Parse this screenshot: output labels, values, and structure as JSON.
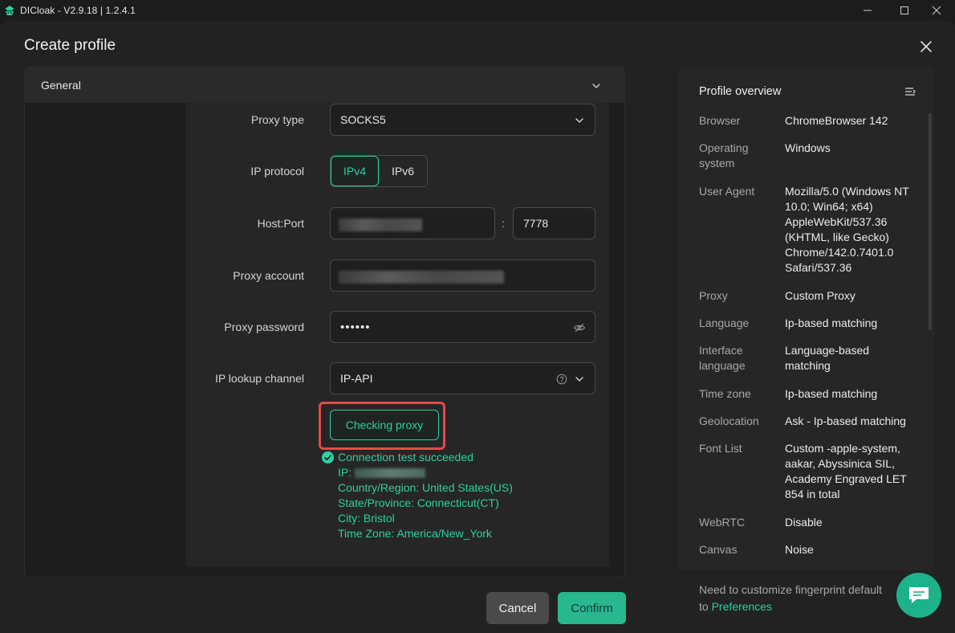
{
  "window": {
    "title": "DICloak - V2.9.18 | 1.2.4.1"
  },
  "dialog": {
    "title": "Create profile"
  },
  "section": {
    "title": "General"
  },
  "form": {
    "proxy_type_label": "Proxy type",
    "proxy_type_value": "SOCKS5",
    "ip_protocol_label": "IP protocol",
    "ip_protocol_options": [
      "IPv4",
      "IPv6"
    ],
    "ip_protocol_selected": "IPv4",
    "host_port_label": "Host:Port",
    "host_port_separator": ":",
    "port_value": "7778",
    "proxy_account_label": "Proxy account",
    "proxy_password_label": "Proxy password",
    "proxy_password_value": "••••••",
    "ip_lookup_label": "IP lookup channel",
    "ip_lookup_value": "IP-API",
    "check_button": "Checking proxy"
  },
  "result": {
    "status": "Connection test succeeded",
    "ip_label": "IP:",
    "country": "Country/Region: United States(US)",
    "state": "State/Province: Connecticut(CT)",
    "city": "City: Bristol",
    "timezone": "Time Zone: America/New_York"
  },
  "footer": {
    "cancel": "Cancel",
    "confirm": "Confirm"
  },
  "overview": {
    "title": "Profile overview",
    "rows": [
      {
        "label": "Browser",
        "value": "ChromeBrowser 142"
      },
      {
        "label": "Operating system",
        "value": "Windows"
      },
      {
        "label": "User Agent",
        "value": "Mozilla/5.0 (Windows NT 10.0; Win64; x64) AppleWebKit/537.36 (KHTML, like Gecko) Chrome/142.0.7401.0 Safari/537.36"
      },
      {
        "label": "Proxy",
        "value": "Custom Proxy"
      },
      {
        "label": "Language",
        "value": "Ip-based matching"
      },
      {
        "label": "Interface language",
        "value": "Language-based matching"
      },
      {
        "label": "Time zone",
        "value": "Ip-based matching"
      },
      {
        "label": "Geolocation",
        "value": "Ask - Ip-based matching"
      },
      {
        "label": "Font List",
        "value": "Custom -apple-system, aakar, Abyssinica SIL, Academy Engraved LET 854 in total"
      },
      {
        "label": "WebRTC",
        "value": "Disable"
      },
      {
        "label": "Canvas",
        "value": "Noise"
      }
    ],
    "footer_text": "Need to customize fingerprint default",
    "footer_to": "to",
    "footer_link": "Preferences"
  },
  "colors": {
    "accent": "#2ad2a2",
    "highlight": "#e34b4b",
    "background": "#222222"
  }
}
